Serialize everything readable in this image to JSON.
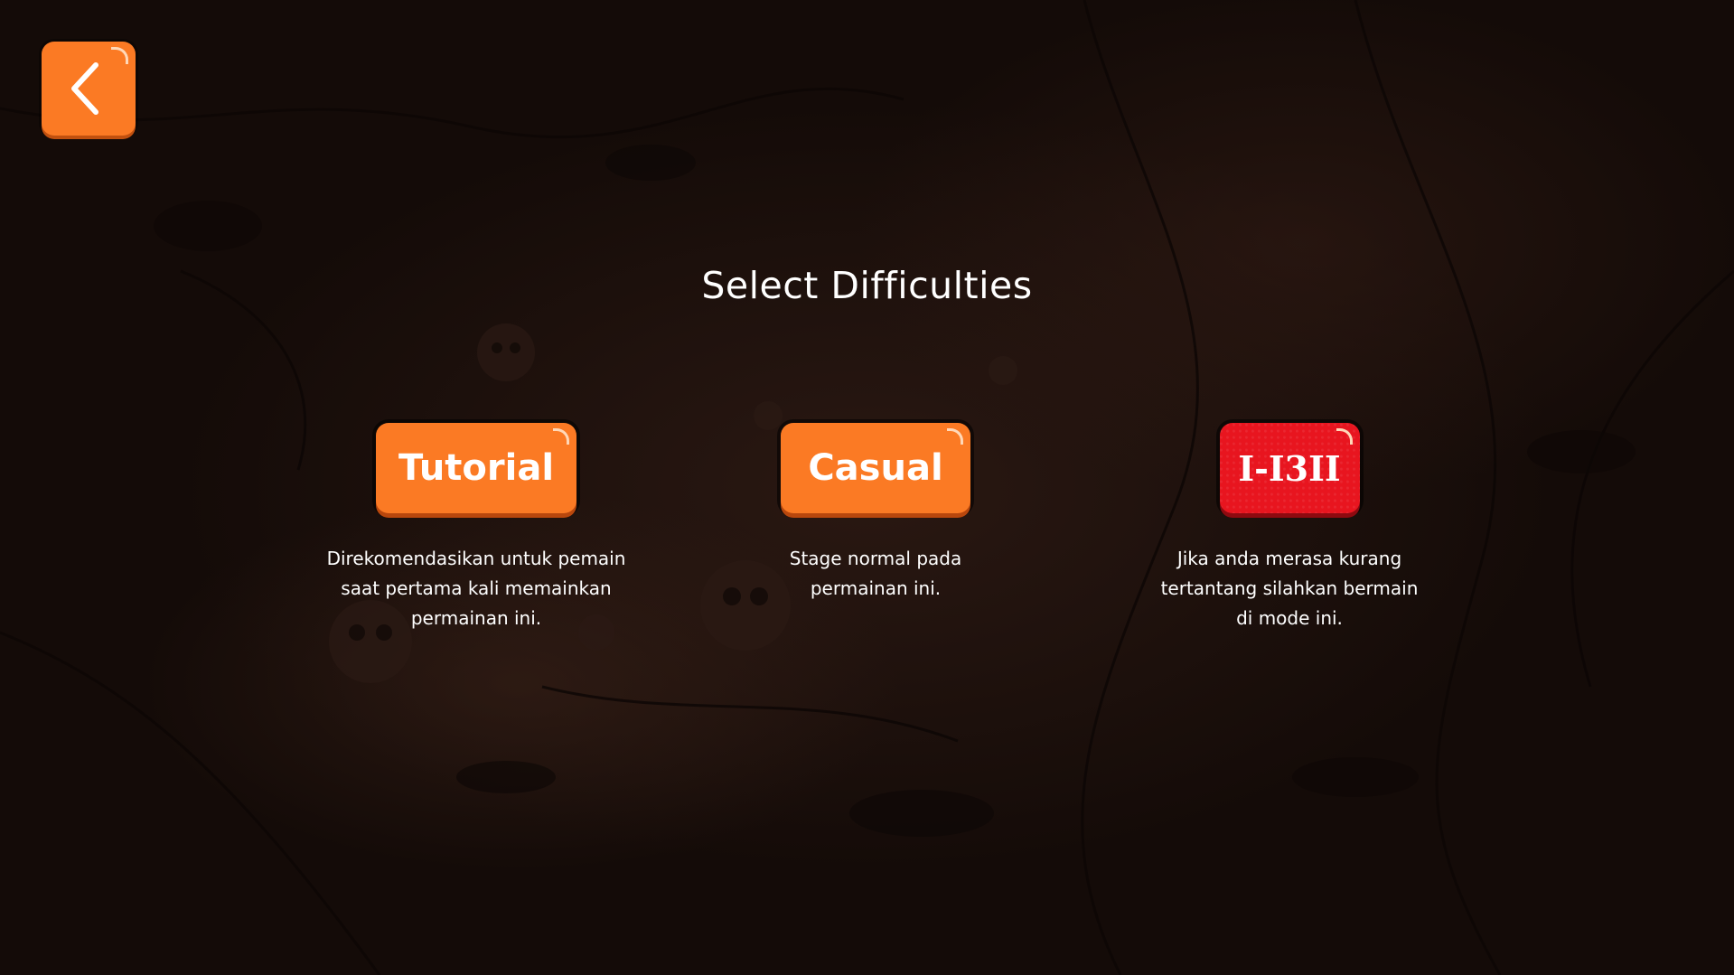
{
  "title": "Select Difficulties",
  "back_button": {
    "icon": "chevron-left-icon"
  },
  "colors": {
    "accent": "#fb7a24",
    "danger": "#e8151f",
    "text": "#ffffff",
    "background": "#1a0f0c"
  },
  "modes": [
    {
      "id": "tutorial",
      "label": "Tutorial",
      "description": "Direkomendasikan untuk pemain\nsaat pertama kali memainkan\npermainan ini."
    },
    {
      "id": "casual",
      "label": "Casual",
      "description": "Stage normal pada\npermainan ini."
    },
    {
      "id": "hard",
      "label": "I-I3II",
      "description": "Jika anda merasa kurang\ntertantang silahkan bermain\ndi mode ini."
    }
  ]
}
